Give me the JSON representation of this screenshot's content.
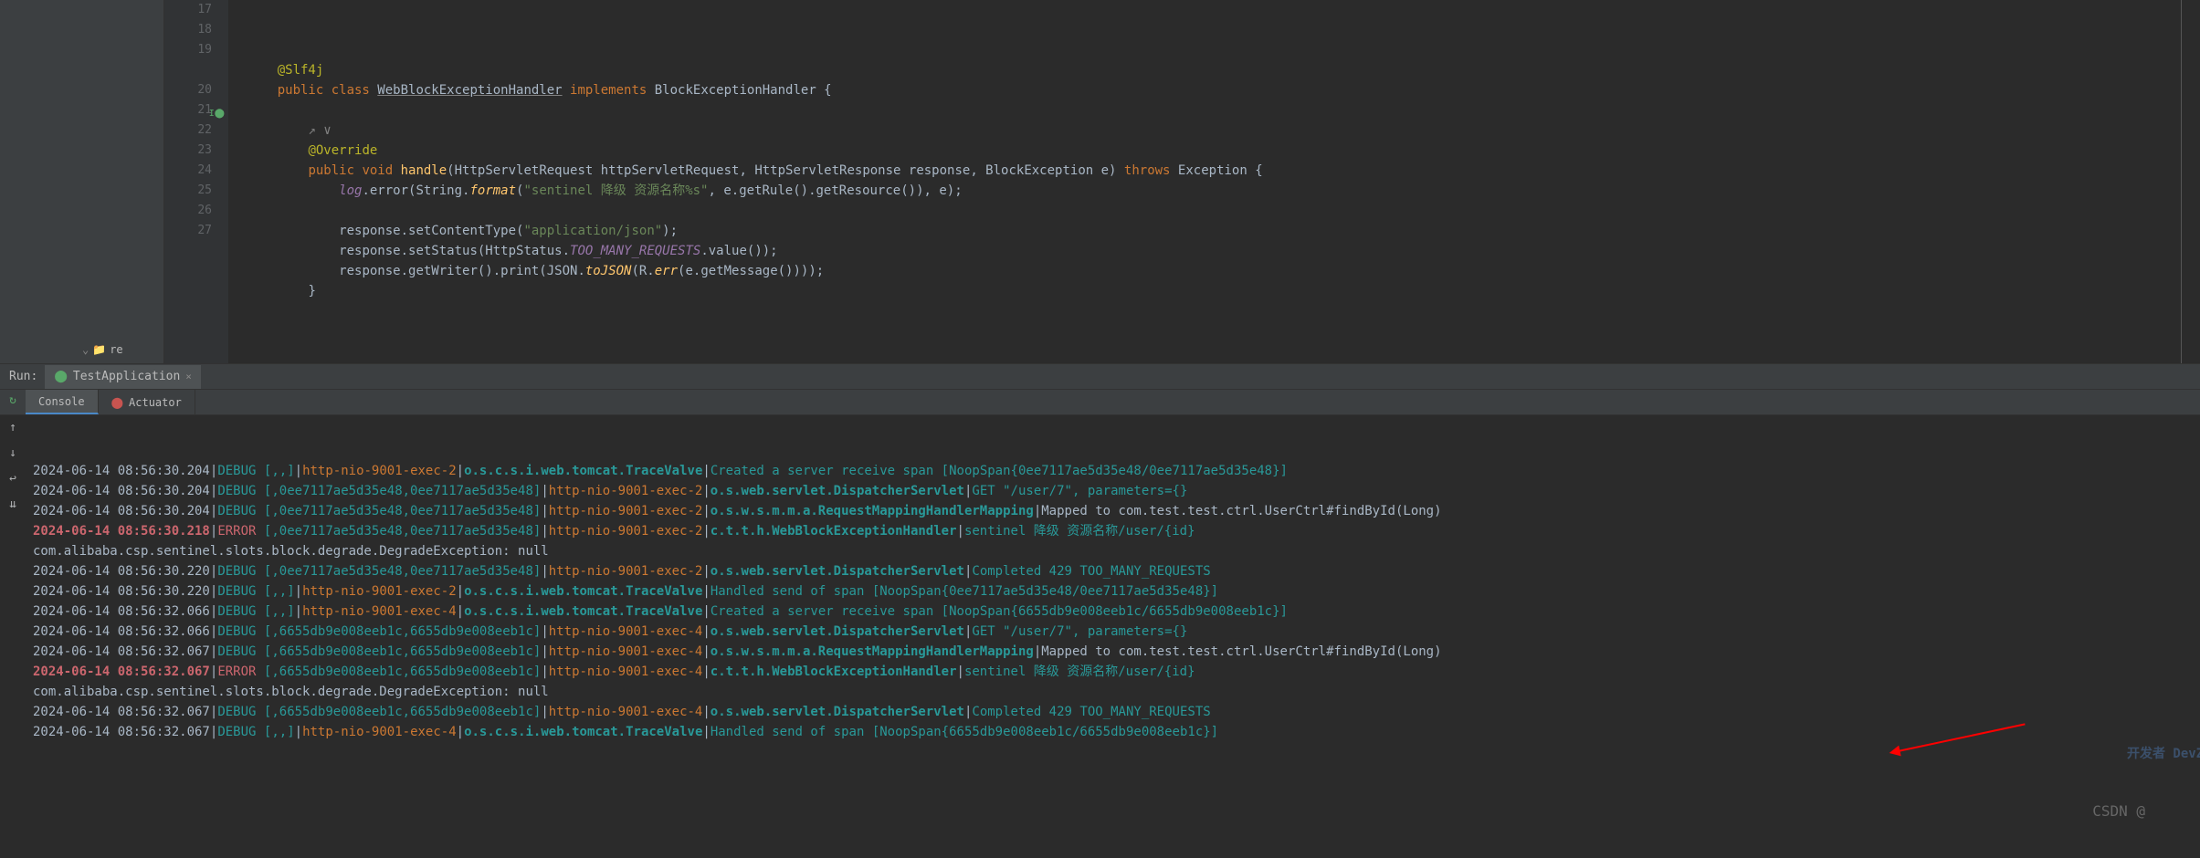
{
  "editor": {
    "lines": [
      {
        "num": "17",
        "indent": 1,
        "tokens": [
          {
            "t": "@Slf4j",
            "c": "ann"
          }
        ]
      },
      {
        "num": "18",
        "indent": 1,
        "tokens": [
          {
            "t": "public class ",
            "c": "kw"
          },
          {
            "t": "WebBlockExceptionHandler",
            "c": "underline"
          },
          {
            "t": " implements ",
            "c": "kw"
          },
          {
            "t": "BlockExceptionHandler {",
            "c": "param"
          }
        ]
      },
      {
        "num": "19",
        "indent": 1,
        "tokens": []
      },
      {
        "num": "",
        "indent": 2,
        "tokens": [
          {
            "t": "↗ ∨",
            "c": "comment-hint"
          }
        ]
      },
      {
        "num": "20",
        "indent": 2,
        "tokens": [
          {
            "t": "@Override",
            "c": "ann"
          }
        ]
      },
      {
        "num": "21",
        "indent": 2,
        "icon": "impl",
        "tokens": [
          {
            "t": "public void ",
            "c": "kw"
          },
          {
            "t": "handle",
            "c": "method"
          },
          {
            "t": "(HttpServletRequest httpServletRequest, HttpServletResponse response, BlockException e) ",
            "c": "param"
          },
          {
            "t": "throws ",
            "c": "kw"
          },
          {
            "t": "Exception {",
            "c": "param"
          }
        ]
      },
      {
        "num": "22",
        "indent": 3,
        "tokens": [
          {
            "t": "log",
            "c": "field-italic"
          },
          {
            "t": ".error(String.",
            "c": "param"
          },
          {
            "t": "format",
            "c": "static-method"
          },
          {
            "t": "(",
            "c": "param"
          },
          {
            "t": "\"sentinel 降级 资源名称%s\"",
            "c": "str"
          },
          {
            "t": ", e.getRule().getResource()), e);",
            "c": "param"
          }
        ]
      },
      {
        "num": "23",
        "indent": 3,
        "tokens": []
      },
      {
        "num": "24",
        "indent": 3,
        "tokens": [
          {
            "t": "response.setContentType(",
            "c": "param"
          },
          {
            "t": "\"application/json\"",
            "c": "str"
          },
          {
            "t": ");",
            "c": "param"
          }
        ]
      },
      {
        "num": "25",
        "indent": 3,
        "tokens": [
          {
            "t": "response.setStatus(HttpStatus.",
            "c": "param"
          },
          {
            "t": "TOO_MANY_REQUESTS",
            "c": "field-italic"
          },
          {
            "t": ".value());",
            "c": "param"
          }
        ]
      },
      {
        "num": "26",
        "indent": 3,
        "tokens": [
          {
            "t": "response.getWriter().print(JSON.",
            "c": "param"
          },
          {
            "t": "toJSON",
            "c": "static-method"
          },
          {
            "t": "(R.",
            "c": "param"
          },
          {
            "t": "err",
            "c": "static-method"
          },
          {
            "t": "(e.getMessage())));",
            "c": "param"
          }
        ]
      },
      {
        "num": "27",
        "indent": 2,
        "tokens": [
          {
            "t": "}",
            "c": "param"
          }
        ]
      }
    ]
  },
  "run": {
    "label": "Run:",
    "app_tab": "TestApplication",
    "tabs": {
      "console": "Console",
      "actuator": "Actuator"
    }
  },
  "logs": [
    {
      "ts": "2024-06-14 08:56:30.204",
      "lvl": "DEBUG",
      "lc": "log-debug",
      "trace": "[,,]",
      "thread": "http-nio-9001-exec-2",
      "logger": "o.s.c.s.i.web.tomcat.TraceValve",
      "msg": "Created a server receive span [NoopSpan{0ee7117ae5d35e48/0ee7117ae5d35e48}]",
      "mc": "log-span"
    },
    {
      "ts": "2024-06-14 08:56:30.204",
      "lvl": "DEBUG",
      "lc": "log-debug",
      "trace": "[,0ee7117ae5d35e48,0ee7117ae5d35e48]",
      "thread": "http-nio-9001-exec-2",
      "logger": "o.s.web.servlet.DispatcherServlet",
      "msg": "GET \"/user/7\", parameters={}",
      "mc": "log-span"
    },
    {
      "ts": "2024-06-14 08:56:30.204",
      "lvl": "DEBUG",
      "lc": "log-debug",
      "trace": "[,0ee7117ae5d35e48,0ee7117ae5d35e48]",
      "thread": "http-nio-9001-exec-2",
      "logger": "o.s.w.s.m.m.a.RequestMappingHandlerMapping",
      "msg": "Mapped to com.test.test.ctrl.UserCtrl#findById(Long)",
      "mc": "log-msg"
    },
    {
      "ts": "2024-06-14 08:56:30.218",
      "tsc": "log-red-ts",
      "lvl": "ERROR",
      "lc": "log-error",
      "trace": "[,0ee7117ae5d35e48,0ee7117ae5d35e48]",
      "thread": "http-nio-9001-exec-2",
      "logger": "c.t.t.h.WebBlockExceptionHandler",
      "msg": "sentinel 降级 资源名称/user/{id}",
      "mc": "log-span"
    },
    {
      "raw": "com.alibaba.csp.sentinel.slots.block.degrade.DegradeException: null"
    },
    {
      "ts": "2024-06-14 08:56:30.220",
      "lvl": "DEBUG",
      "lc": "log-debug",
      "trace": "[,0ee7117ae5d35e48,0ee7117ae5d35e48]",
      "thread": "http-nio-9001-exec-2",
      "logger": "o.s.web.servlet.DispatcherServlet",
      "msg": "Completed 429 TOO_MANY_REQUESTS",
      "mc": "log-span"
    },
    {
      "ts": "2024-06-14 08:56:30.220",
      "lvl": "DEBUG",
      "lc": "log-debug",
      "trace": "[,,]",
      "thread": "http-nio-9001-exec-2",
      "logger": "o.s.c.s.i.web.tomcat.TraceValve",
      "msg": "Handled send of span [NoopSpan{0ee7117ae5d35e48/0ee7117ae5d35e48}]",
      "mc": "log-span"
    },
    {
      "ts": "2024-06-14 08:56:32.066",
      "lvl": "DEBUG",
      "lc": "log-debug",
      "trace": "[,,]",
      "thread": "http-nio-9001-exec-4",
      "logger": "o.s.c.s.i.web.tomcat.TraceValve",
      "msg": "Created a server receive span [NoopSpan{6655db9e008eeb1c/6655db9e008eeb1c}]",
      "mc": "log-span"
    },
    {
      "ts": "2024-06-14 08:56:32.066",
      "lvl": "DEBUG",
      "lc": "log-debug",
      "trace": "[,6655db9e008eeb1c,6655db9e008eeb1c]",
      "thread": "http-nio-9001-exec-4",
      "logger": "o.s.web.servlet.DispatcherServlet",
      "msg": "GET \"/user/7\", parameters={}",
      "mc": "log-span"
    },
    {
      "ts": "2024-06-14 08:56:32.067",
      "lvl": "DEBUG",
      "lc": "log-debug",
      "trace": "[,6655db9e008eeb1c,6655db9e008eeb1c]",
      "thread": "http-nio-9001-exec-4",
      "logger": "o.s.w.s.m.m.a.RequestMappingHandlerMapping",
      "msg": "Mapped to com.test.test.ctrl.UserCtrl#findById(Long)",
      "mc": "log-msg"
    },
    {
      "ts": "2024-06-14 08:56:32.067",
      "tsc": "log-red-ts",
      "lvl": "ERROR",
      "lc": "log-error",
      "trace": "[,6655db9e008eeb1c,6655db9e008eeb1c]",
      "thread": "http-nio-9001-exec-4",
      "logger": "c.t.t.h.WebBlockExceptionHandler",
      "msg": "sentinel 降级 资源名称/user/{id}",
      "mc": "log-span"
    },
    {
      "raw": "com.alibaba.csp.sentinel.slots.block.degrade.DegradeException: null"
    },
    {
      "ts": "2024-06-14 08:56:32.067",
      "lvl": "DEBUG",
      "lc": "log-debug",
      "trace": "[,6655db9e008eeb1c,6655db9e008eeb1c]",
      "thread": "http-nio-9001-exec-4",
      "logger": "o.s.web.servlet.DispatcherServlet",
      "msg": "Completed 429 TOO_MANY_REQUESTS",
      "mc": "log-span"
    },
    {
      "ts": "2024-06-14 08:56:32.067",
      "lvl": "DEBUG",
      "lc": "log-debug",
      "trace": "[,,]",
      "thread": "http-nio-9001-exec-4",
      "logger": "o.s.c.s.i.web.tomcat.TraceValve",
      "msg": "Handled send of span [NoopSpan{6655db9e008eeb1c/6655db9e008eeb1c}]",
      "mc": "log-span"
    }
  ],
  "watermark": "CSDN @",
  "logo": "开发者 DevZe.CoM",
  "tree_label": "re"
}
